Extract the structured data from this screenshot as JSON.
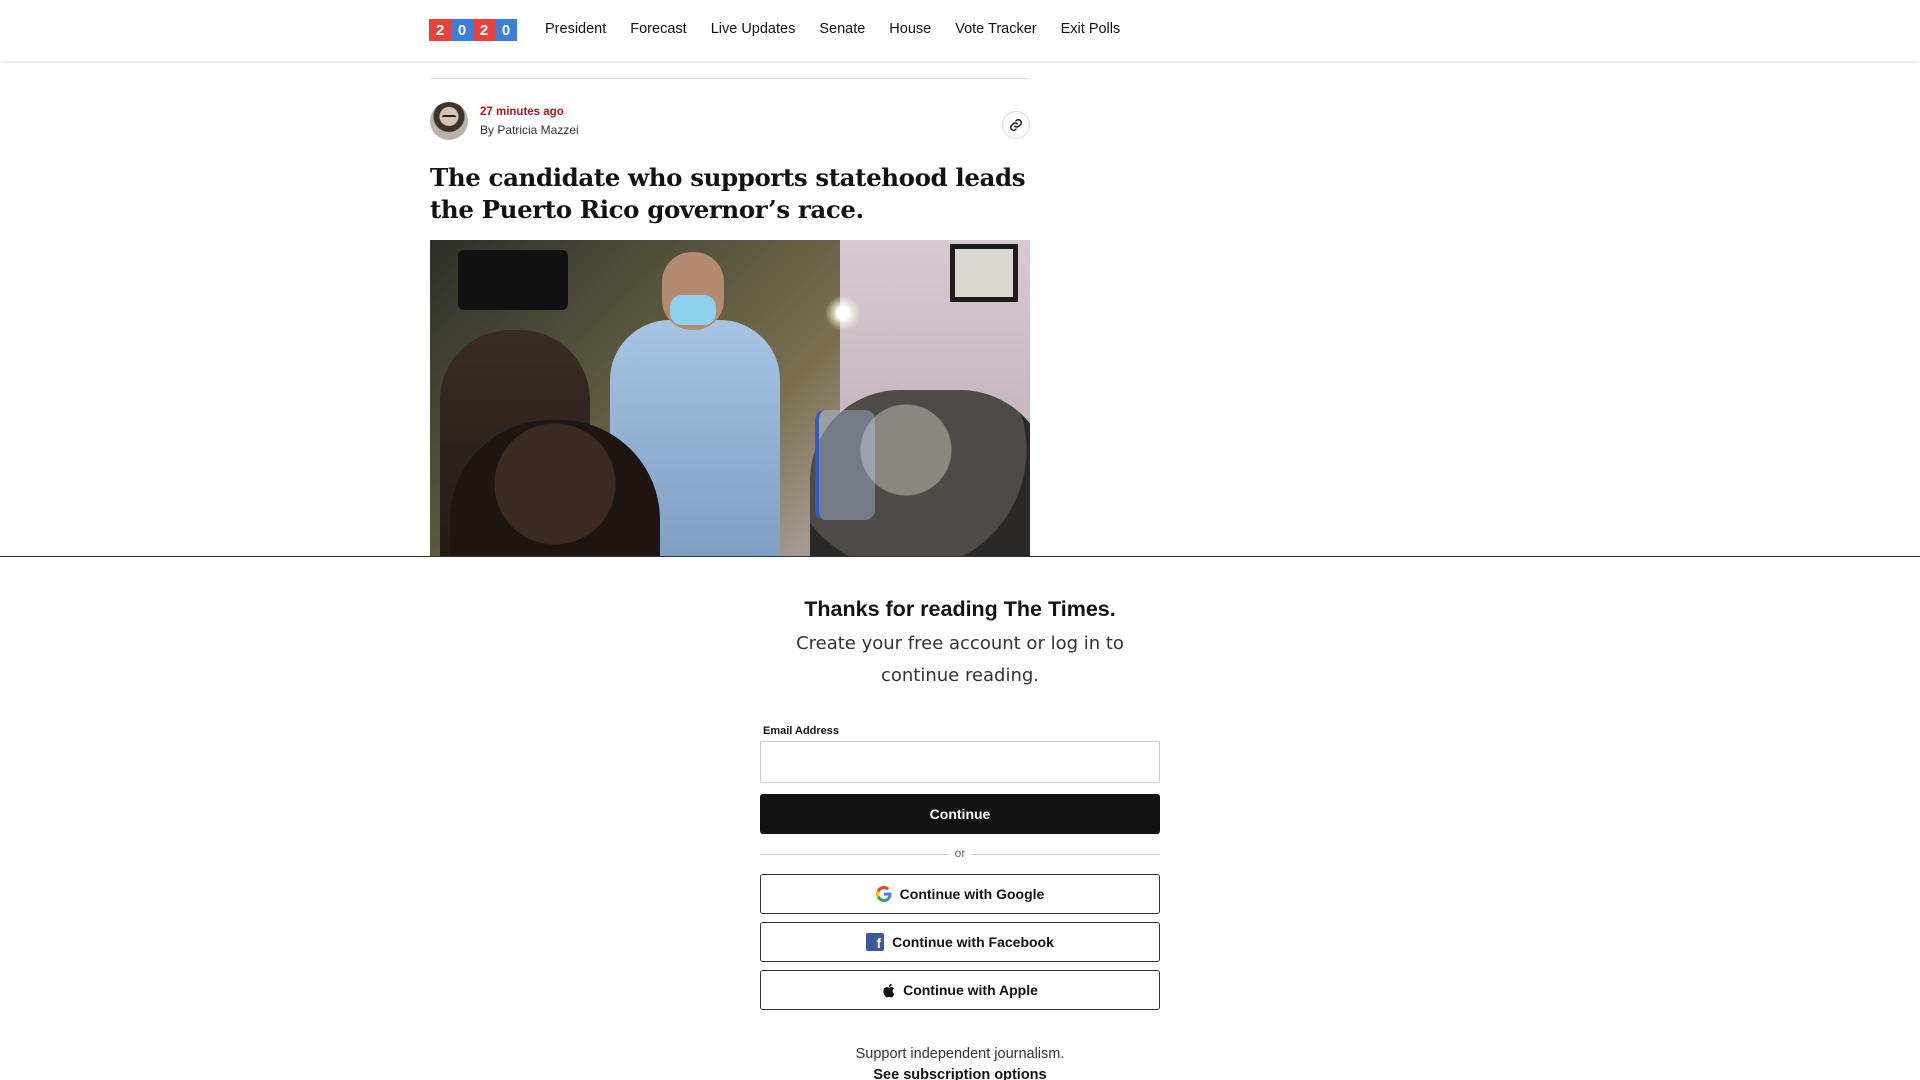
{
  "nav": {
    "logo_digits": [
      "2",
      "0",
      "2",
      "0"
    ],
    "logo_colors": [
      "#e8423f",
      "#3d7fd6",
      "#e8423f",
      "#3d7fd6"
    ],
    "items": [
      "President",
      "Forecast",
      "Live Updates",
      "Senate",
      "House",
      "Vote Tracker",
      "Exit Polls"
    ]
  },
  "article": {
    "timestamp": "27 minutes ago",
    "byline": "By Patricia Mazzei",
    "headline": "The candidate who supports statehood leads the Puerto Rico governor’s race.",
    "link_icon": "link-icon"
  },
  "gate": {
    "title": "Thanks for reading The Times.",
    "subtitle": "Create your free account or log in to continue reading.",
    "email_label": "Email Address",
    "email_value": "",
    "continue_label": "Continue",
    "or_label": "or",
    "google_label": "Continue with Google",
    "facebook_label": "Continue with Facebook",
    "apple_label": "Continue with Apple",
    "support_text": "Support independent journalism.",
    "subscription_link": "See subscription options"
  },
  "colors": {
    "timestamp_red": "#b3141f",
    "button_dark": "#121212",
    "facebook_blue": "#3b5998"
  }
}
